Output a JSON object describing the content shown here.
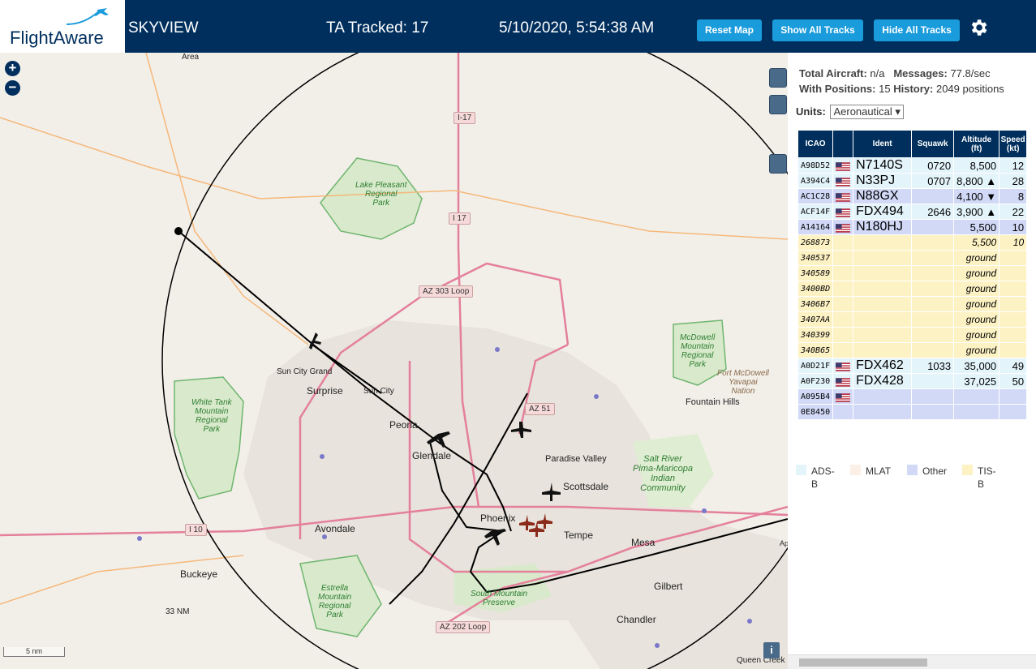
{
  "header": {
    "logo_text": "FlightAware",
    "title": "SKYVIEW",
    "tracked": "TA Tracked: 17",
    "datetime": "5/10/2020, 5:54:38 AM",
    "reset_map": "Reset Map",
    "show_all_tracks": "Show All Tracks",
    "hide_all_tracks": "Hide All Tracks"
  },
  "map": {
    "zoom_in": "+",
    "zoom_out": "−",
    "scale_label": "5 nm",
    "range_ring_label": "33 NM",
    "info_label": "i",
    "places": {
      "surprise": "Surprise",
      "sun_city_grand": "Sun City Grand",
      "sun_city": "Sun City",
      "peoria": "Peoria",
      "glendale": "Glendale",
      "phoenix": "Phoenix",
      "paradise_valley": "Paradise Valley",
      "scottsdale": "Scottsdale",
      "fountain_hills": "Fountain Hills",
      "avondale": "Avondale",
      "buckeye": "Buckeye",
      "tempe": "Tempe",
      "mesa": "Mesa",
      "gilbert": "Gilbert",
      "chandler": "Chandler",
      "queen_creek": "Queen Creek",
      "area": "Area",
      "ap": "Ap"
    },
    "parks": {
      "lake_pleasant": "Lake Pleasant\nRegional\nPark",
      "white_tank": "White Tank\nMountain\nRegional\nPark",
      "mcdowell": "McDowell\nMountain\nRegional\nPark",
      "fort_mcdowell": "Fort McDowell\nYavapai\nNation",
      "salt_river": "Salt River\nPima-Maricopa\nIndian\nCommunity",
      "estrella": "Estrella\nMountain\nRegional\nPark",
      "south_mountain": "South Mountain\nPreserve"
    },
    "roads": {
      "i17_top": "I-17",
      "i17": "I 17",
      "az303": "AZ 303 Loop",
      "az51": "AZ 51",
      "i10": "I 10",
      "az202": "AZ 202 Loop"
    }
  },
  "sidebar": {
    "total_aircraft_label": "Total Aircraft:",
    "total_aircraft_value": "n/a",
    "messages_label": "Messages:",
    "messages_value": "77.8/sec",
    "with_positions_label": "With Positions:",
    "with_positions_value": "15",
    "history_label": "History:",
    "history_value": "2049 positions",
    "units_label": "Units:",
    "units_value": "Aeronautical",
    "columns": {
      "icao": "ICAO",
      "ident": "Ident",
      "squawk": "Squawk",
      "altitude": "Altitude",
      "altitude_unit": "(ft)",
      "speed": "Speed",
      "speed_unit": "(kt)"
    },
    "rows": [
      {
        "icao": "A98D52",
        "flag": true,
        "ident": "N7140S",
        "squawk": "0720",
        "altitude": "8,500",
        "speed": "12",
        "type": "adsb"
      },
      {
        "icao": "A394C4",
        "flag": true,
        "ident": "N33PJ",
        "squawk": "0707",
        "altitude": "8,800 ▲",
        "speed": "28",
        "type": "adsb"
      },
      {
        "icao": "AC1C28",
        "flag": true,
        "ident": "N88GX",
        "squawk": "",
        "altitude": "4,100 ▼",
        "speed": "8",
        "type": "other"
      },
      {
        "icao": "ACF14F",
        "flag": true,
        "ident": "FDX494",
        "squawk": "2646",
        "altitude": "3,900 ▲",
        "speed": "22",
        "type": "adsb"
      },
      {
        "icao": "A14164",
        "flag": true,
        "ident": "N180HJ",
        "squawk": "",
        "altitude": "5,500",
        "speed": "10",
        "type": "other"
      },
      {
        "icao": "268873",
        "flag": false,
        "ident": "",
        "squawk": "",
        "altitude": "5,500",
        "speed": "10",
        "type": "tisb"
      },
      {
        "icao": "340537",
        "flag": false,
        "ident": "",
        "squawk": "",
        "altitude": "ground",
        "speed": "",
        "type": "tisb"
      },
      {
        "icao": "340589",
        "flag": false,
        "ident": "",
        "squawk": "",
        "altitude": "ground",
        "speed": "",
        "type": "tisb"
      },
      {
        "icao": "3400BD",
        "flag": false,
        "ident": "",
        "squawk": "",
        "altitude": "ground",
        "speed": "",
        "type": "tisb"
      },
      {
        "icao": "3406B7",
        "flag": false,
        "ident": "",
        "squawk": "",
        "altitude": "ground",
        "speed": "",
        "type": "tisb"
      },
      {
        "icao": "3407AA",
        "flag": false,
        "ident": "",
        "squawk": "",
        "altitude": "ground",
        "speed": "",
        "type": "tisb"
      },
      {
        "icao": "340399",
        "flag": false,
        "ident": "",
        "squawk": "",
        "altitude": "ground",
        "speed": "",
        "type": "tisb"
      },
      {
        "icao": "340B65",
        "flag": false,
        "ident": "",
        "squawk": "",
        "altitude": "ground",
        "speed": "",
        "type": "tisb"
      },
      {
        "icao": "A0D21F",
        "flag": true,
        "ident": "FDX462",
        "squawk": "1033",
        "altitude": "35,000",
        "speed": "49",
        "type": "adsb"
      },
      {
        "icao": "A0F230",
        "flag": true,
        "ident": "FDX428",
        "squawk": "",
        "altitude": "37,025",
        "speed": "50",
        "type": "adsb"
      },
      {
        "icao": "A095B4",
        "flag": true,
        "ident": "",
        "squawk": "",
        "altitude": "",
        "speed": "",
        "type": "other"
      },
      {
        "icao": "0E8450",
        "flag": false,
        "ident": "",
        "squawk": "",
        "altitude": "",
        "speed": "",
        "type": "other"
      }
    ],
    "legend": {
      "adsb": "ADS-B",
      "mlat": "MLAT",
      "other": "Other",
      "tisb": "TIS-B"
    }
  },
  "colors": {
    "header_bg": "#002f5d",
    "button_bg": "#1a9bdc",
    "adsb": "#e4f4fb",
    "mlat": "#fcefe6",
    "other": "#d1d9f7",
    "tisb": "#fdf2c4"
  }
}
